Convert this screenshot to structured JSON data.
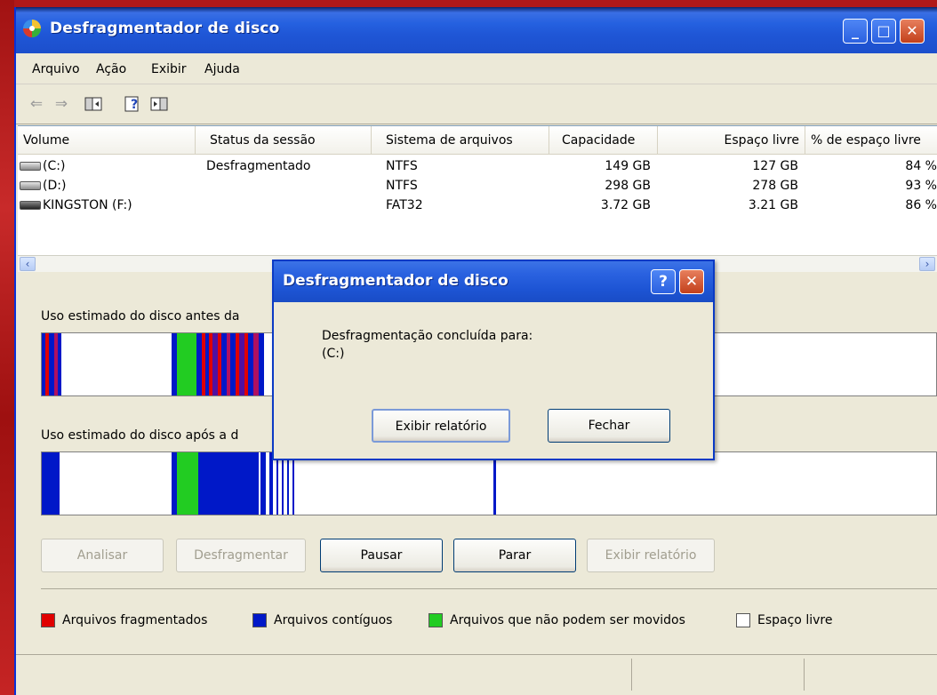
{
  "window": {
    "title": "Desfragmentador de disco",
    "controls": {
      "minimize": "_",
      "maximize": "□",
      "close": "✕"
    }
  },
  "menu": [
    "Arquivo",
    "Ação",
    "Exibir",
    "Ajuda"
  ],
  "toolbar_icons": [
    "back-arrow-icon",
    "forward-arrow-icon",
    "show-hide-console-tree-icon",
    "help-icon",
    "properties-pane-icon"
  ],
  "table": {
    "columns": [
      "Volume",
      "Status da sessão",
      "Sistema de arquivos",
      "Capacidade",
      "Espaço livre",
      "% de espaço livre"
    ],
    "rows": [
      {
        "volume": "(C:)",
        "status": "Desfragmentado",
        "fs": "NTFS",
        "capacity": "149 GB",
        "free": "127 GB",
        "pct": "84 %"
      },
      {
        "volume": "(D:)",
        "status": "",
        "fs": "NTFS",
        "capacity": "298 GB",
        "free": "278 GB",
        "pct": "93 %"
      },
      {
        "volume": "KINGSTON (F:)",
        "status": "",
        "fs": "FAT32",
        "capacity": "3.72 GB",
        "free": "3.21 GB",
        "pct": "86 %"
      }
    ]
  },
  "analysis": {
    "before_label": "Uso estimado do disco antes da",
    "after_label": "Uso estimado do disco após a d"
  },
  "buttons": {
    "analyze": "Analisar",
    "defrag": "Desfragmentar",
    "pause": "Pausar",
    "stop": "Parar",
    "view_report": "Exibir relatório"
  },
  "legend": [
    {
      "label": "Arquivos fragmentados",
      "color": "#e00000"
    },
    {
      "label": "Arquivos contíguos",
      "color": "#0018c8"
    },
    {
      "label": "Arquivos que não podem ser movidos",
      "color": "#22cc22"
    },
    {
      "label": "Espaço livre",
      "color": "#ffffff"
    }
  ],
  "dialog": {
    "title": "Desfragmentador de disco",
    "message_line1": "Desfragmentação concluída para:",
    "message_line2": "(C:)",
    "view_report": "Exibir relatório",
    "close": "Fechar",
    "help_glyph": "?",
    "close_glyph": "✕"
  },
  "colors": {
    "fragmented": "#e00000",
    "contiguous": "#0018c8",
    "unmovable": "#22cc22",
    "free": "#ffffff"
  }
}
